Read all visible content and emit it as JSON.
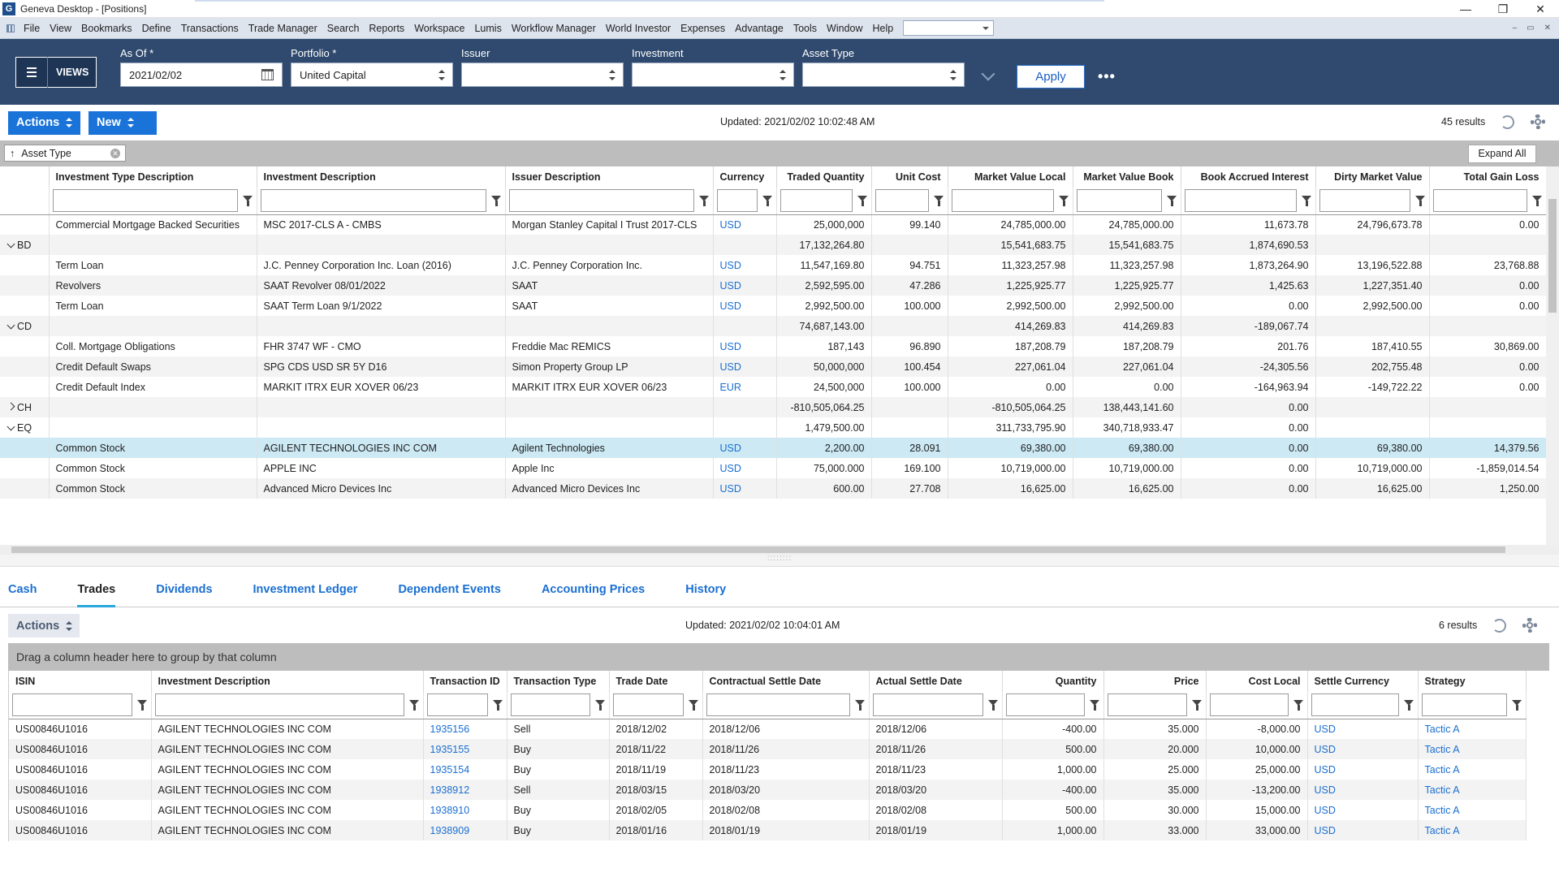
{
  "window": {
    "title": "Geneva Desktop - [Positions]",
    "app_icon": "G"
  },
  "menu": {
    "items": [
      "File",
      "View",
      "Bookmarks",
      "Define",
      "Transactions",
      "Trade Manager",
      "Search",
      "Reports",
      "Workspace",
      "Lumis",
      "Workflow Manager",
      "World Investor",
      "Expenses",
      "Advantage",
      "Tools",
      "Window",
      "Help"
    ]
  },
  "filters": {
    "views_label": "VIEWS",
    "as_of": {
      "label": "As Of *",
      "value": "2021/02/02"
    },
    "portfolio": {
      "label": "Portfolio *",
      "value": "United Capital"
    },
    "issuer": {
      "label": "Issuer",
      "value": ""
    },
    "investment": {
      "label": "Investment",
      "value": ""
    },
    "asset_type": {
      "label": "Asset Type",
      "value": ""
    },
    "apply_label": "Apply",
    "more_label": "•••"
  },
  "positions": {
    "actions_label": "Actions",
    "new_label": "New",
    "updated": "Updated: 2021/02/02 10:02:48 AM",
    "results": "45 results",
    "group_chip": "Asset Type",
    "expand_all": "Expand All",
    "columns": [
      "Investment Type Description",
      "Investment Description",
      "Issuer Description",
      "Currency",
      "Traded Quantity",
      "Unit Cost",
      "Market Value Local",
      "Market Value Book",
      "Book Accrued Interest",
      "Dirty Market Value",
      "Total Gain Loss"
    ],
    "rows": [
      {
        "kind": "data",
        "cells": [
          "Commercial Mortgage Backed Securities",
          "MSC 2017-CLS A - CMBS",
          "Morgan Stanley Capital I Trust 2017-CLS",
          "USD",
          "25,000,000",
          "99.140",
          "24,785,000.00",
          "24,785,000.00",
          "11,673.78",
          "24,796,673.78",
          "0.00"
        ]
      },
      {
        "kind": "group",
        "open": true,
        "cells": [
          "BD",
          "",
          "",
          "",
          "17,132,264.80",
          "",
          "15,541,683.75",
          "15,541,683.75",
          "1,874,690.53",
          "",
          ""
        ]
      },
      {
        "kind": "data",
        "cells": [
          "Term Loan",
          "J.C. Penney Corporation Inc. Loan (2016)",
          "J.C. Penney Corporation Inc.",
          "USD",
          "11,547,169.80",
          "94.751",
          "11,323,257.98",
          "11,323,257.98",
          "1,873,264.90",
          "13,196,522.88",
          "23,768.88"
        ]
      },
      {
        "kind": "data",
        "cells": [
          "Revolvers",
          "SAAT Revolver 08/01/2022",
          "SAAT",
          "USD",
          "2,592,595.00",
          "47.286",
          "1,225,925.77",
          "1,225,925.77",
          "1,425.63",
          "1,227,351.40",
          "0.00"
        ]
      },
      {
        "kind": "data",
        "cells": [
          "Term Loan",
          "SAAT Term Loan 9/1/2022",
          "SAAT",
          "USD",
          "2,992,500.00",
          "100.000",
          "2,992,500.00",
          "2,992,500.00",
          "0.00",
          "2,992,500.00",
          "0.00"
        ]
      },
      {
        "kind": "group",
        "open": true,
        "cells": [
          "CD",
          "",
          "",
          "",
          "74,687,143.00",
          "",
          "414,269.83",
          "414,269.83",
          "-189,067.74",
          "",
          ""
        ]
      },
      {
        "kind": "data",
        "cells": [
          "Coll. Mortgage Obligations",
          "FHR 3747 WF - CMO",
          "Freddie Mac REMICS",
          "USD",
          "187,143",
          "96.890",
          "187,208.79",
          "187,208.79",
          "201.76",
          "187,410.55",
          "30,869.00"
        ]
      },
      {
        "kind": "data",
        "cells": [
          "Credit Default Swaps",
          "SPG CDS USD SR 5Y D16",
          "Simon Property Group LP",
          "USD",
          "50,000,000",
          "100.454",
          "227,061.04",
          "227,061.04",
          "-24,305.56",
          "202,755.48",
          "0.00"
        ]
      },
      {
        "kind": "data",
        "cells": [
          "Credit Default Index",
          "MARKIT ITRX EUR XOVER 06/23",
          "MARKIT ITRX EUR XOVER 06/23",
          "EUR",
          "24,500,000",
          "100.000",
          "0.00",
          "0.00",
          "-164,963.94",
          "-149,722.22",
          "0.00"
        ]
      },
      {
        "kind": "group",
        "open": false,
        "cells": [
          "CH",
          "",
          "",
          "",
          "-810,505,064.25",
          "",
          "-810,505,064.25",
          "138,443,141.60",
          "0.00",
          "",
          ""
        ]
      },
      {
        "kind": "group",
        "open": true,
        "cells": [
          "EQ",
          "",
          "",
          "",
          "1,479,500.00",
          "",
          "311,733,795.90",
          "340,718,933.47",
          "0.00",
          "",
          ""
        ]
      },
      {
        "kind": "data",
        "selected": true,
        "cells": [
          "Common Stock",
          "AGILENT TECHNOLOGIES INC COM",
          "Agilent Technologies",
          "USD",
          "2,200.00",
          "28.091",
          "69,380.00",
          "69,380.00",
          "0.00",
          "69,380.00",
          "14,379.56"
        ]
      },
      {
        "kind": "data",
        "cells": [
          "Common Stock",
          "APPLE INC",
          "Apple Inc",
          "USD",
          "75,000.000",
          "169.100",
          "10,719,000.00",
          "10,719,000.00",
          "0.00",
          "10,719,000.00",
          "-1,859,014.54"
        ]
      },
      {
        "kind": "data",
        "cells": [
          "Common Stock",
          "Advanced Micro Devices Inc",
          "Advanced Micro Devices Inc",
          "USD",
          "600.00",
          "27.708",
          "16,625.00",
          "16,625.00",
          "0.00",
          "16,625.00",
          "1,250.00"
        ]
      }
    ]
  },
  "bottom": {
    "tabs": [
      "Cash",
      "Trades",
      "Dividends",
      "Investment Ledger",
      "Dependent Events",
      "Accounting Prices",
      "History"
    ],
    "active_tab": "Trades",
    "actions_label": "Actions",
    "updated": "Updated: 2021/02/02 10:04:01 AM",
    "results": "6 results",
    "drag_hint": "Drag a column header here to group by that column",
    "columns": [
      "ISIN",
      "Investment Description",
      "Transaction ID",
      "Transaction Type",
      "Trade Date",
      "Contractual Settle Date",
      "Actual Settle Date",
      "Quantity",
      "Price",
      "Cost Local",
      "Settle Currency",
      "Strategy"
    ],
    "rows": [
      [
        "US00846U1016",
        "AGILENT TECHNOLOGIES INC COM",
        "1935156",
        "Sell",
        "2018/12/02",
        "2018/12/06",
        "2018/12/06",
        "-400.00",
        "35.000",
        "-8,000.00",
        "USD",
        "Tactic A"
      ],
      [
        "US00846U1016",
        "AGILENT TECHNOLOGIES INC COM",
        "1935155",
        "Buy",
        "2018/11/22",
        "2018/11/26",
        "2018/11/26",
        "500.00",
        "20.000",
        "10,000.00",
        "USD",
        "Tactic A"
      ],
      [
        "US00846U1016",
        "AGILENT TECHNOLOGIES INC COM",
        "1935154",
        "Buy",
        "2018/11/19",
        "2018/11/23",
        "2018/11/23",
        "1,000.00",
        "25.000",
        "25,000.00",
        "USD",
        "Tactic A"
      ],
      [
        "US00846U1016",
        "AGILENT TECHNOLOGIES INC COM",
        "1938912",
        "Sell",
        "2018/03/15",
        "2018/03/20",
        "2018/03/20",
        "-400.00",
        "35.000",
        "-13,200.00",
        "USD",
        "Tactic A"
      ],
      [
        "US00846U1016",
        "AGILENT TECHNOLOGIES INC COM",
        "1938910",
        "Buy",
        "2018/02/05",
        "2018/02/08",
        "2018/02/08",
        "500.00",
        "30.000",
        "15,000.00",
        "USD",
        "Tactic A"
      ],
      [
        "US00846U1016",
        "AGILENT TECHNOLOGIES INC COM",
        "1938909",
        "Buy",
        "2018/01/16",
        "2018/01/19",
        "2018/01/19",
        "1,000.00",
        "33.000",
        "33,000.00",
        "USD",
        "Tactic A"
      ]
    ]
  }
}
